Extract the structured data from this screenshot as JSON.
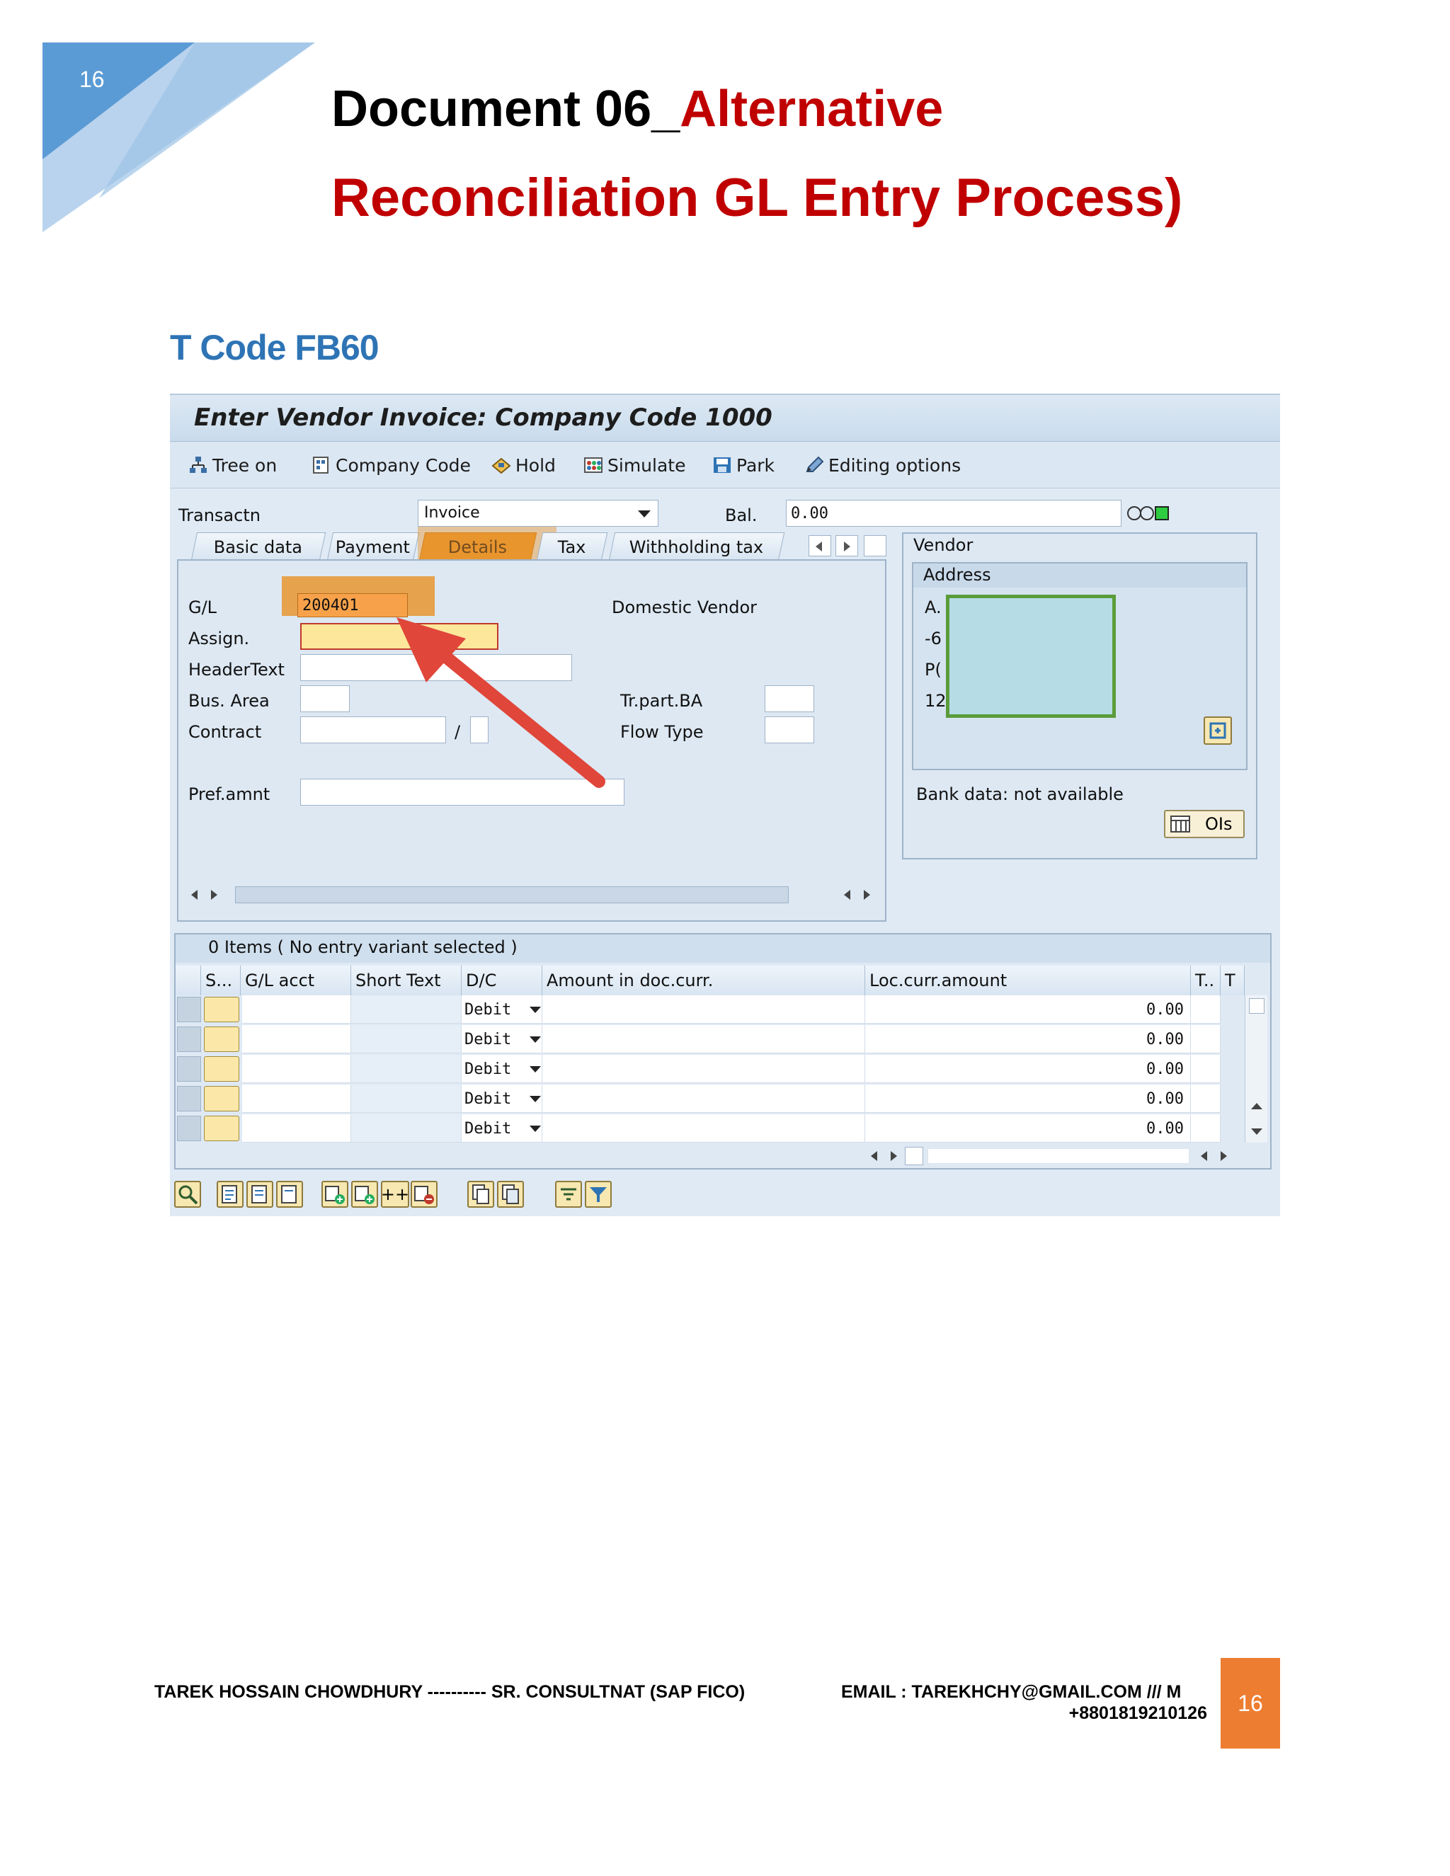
{
  "page": {
    "number": "16",
    "title_part1": "Document 06_",
    "title_part2": "Alternative",
    "title_line2": "Reconciliation GL Entry Process)",
    "tcode_heading": "T Code FB60"
  },
  "sap": {
    "window_title": "Enter Vendor Invoice: Company Code 1000",
    "toolbar": {
      "tree_on": "Tree on",
      "company_code": "Company Code",
      "hold": "Hold",
      "simulate": "Simulate",
      "park": "Park",
      "editing_options": "Editing options"
    },
    "header": {
      "transactn_label": "Transactn",
      "transactn_value": "Invoice",
      "bal_label": "Bal.",
      "bal_value": "0.00"
    },
    "tabs": [
      "Basic data",
      "Payment",
      "Details",
      "Tax",
      "Withholding tax"
    ],
    "active_tab": "Details",
    "details": {
      "gl_label": "G/L",
      "gl_value": "200401",
      "domestic_vendor": "Domestic Vendor",
      "assign_label": "Assign.",
      "headertext_label": "HeaderText",
      "busarea_label": "Bus. Area",
      "trpartba_label": "Tr.part.BA",
      "contract_label": "Contract",
      "contract_sep": "/",
      "flowtype_label": "Flow Type",
      "prefamnt_label": "Pref.amnt"
    },
    "vendor": {
      "title": "Vendor",
      "address_label": "Address",
      "address_lines": [
        "A.",
        "-6",
        "P(",
        "12"
      ],
      "bank_data": "Bank data: not available",
      "ois_button": "OIs"
    },
    "items": {
      "summary": "0 Items ( No entry variant selected )",
      "columns": [
        "S...",
        "G/L acct",
        "Short Text",
        "D/C",
        "Amount in doc.curr.",
        "Loc.curr.amount",
        "T..",
        "T"
      ],
      "rows": [
        {
          "dc": "Debit",
          "loc_amount": "0.00"
        },
        {
          "dc": "Debit",
          "loc_amount": "0.00"
        },
        {
          "dc": "Debit",
          "loc_amount": "0.00"
        },
        {
          "dc": "Debit",
          "loc_amount": "0.00"
        },
        {
          "dc": "Debit",
          "loc_amount": "0.00"
        }
      ],
      "plus_plus": "++"
    },
    "highlight_colors": {
      "orange": "#e8952f",
      "green": "#5b9c3a",
      "arrow": "#e0463a"
    }
  },
  "footer": {
    "left": "TAREK HOSSAIN CHOWDHURY ---------- SR. CONSULTNAT (SAP FICO)",
    "email": "EMAIL : TAREKHCHY@GMAIL.COM /// M",
    "phone": "+8801819210126",
    "page_number": "16"
  }
}
